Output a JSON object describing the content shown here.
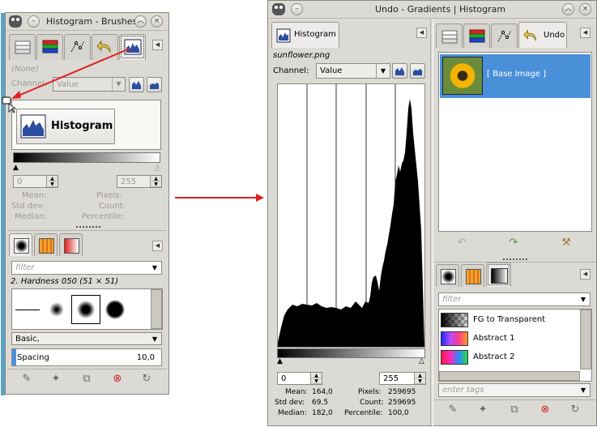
{
  "left_window": {
    "title": "Histogram - Brushes",
    "image_label": "(None)",
    "channel_label": "Channel:",
    "channel_value": "Value",
    "histogram_button_label": "Histogram",
    "range_low": "0",
    "range_high": "255",
    "stats_left": [
      "Mean:",
      "Std dev:",
      "Median:"
    ],
    "stats_right": [
      "Pixels:",
      "Count:",
      "Percentile:"
    ],
    "filter_placeholder": "filter",
    "brush_name": "2. Hardness 050 (51 × 51)",
    "preset": "Basic,",
    "spacing_label": "Spacing",
    "spacing_value": "10,0"
  },
  "right_window": {
    "title": "Undo - Gradients | Histogram",
    "histogram_tab_label": "Histogram",
    "undo_tab_label": "Undo",
    "image_name": "sunflower.png",
    "channel_label": "Channel:",
    "channel_value": "Value",
    "range_low": "0",
    "range_high": "255",
    "stats": [
      {
        "label": "Mean:",
        "value": "164,0"
      },
      {
        "label": "Std dev:",
        "value": "69,5"
      },
      {
        "label": "Median:",
        "value": "182,0"
      }
    ],
    "stats_right": [
      {
        "label": "Pixels:",
        "value": "259695"
      },
      {
        "label": "Count:",
        "value": "259695"
      },
      {
        "label": "Percentile:",
        "value": "100,0"
      }
    ],
    "undo_item": "[ Base Image ]",
    "filter_placeholder": "filter",
    "gradients": [
      "FG to Transparent",
      "Abstract 1",
      "Abstract 2"
    ],
    "tags_placeholder": "enter tags"
  },
  "colors": {
    "window_bg": "#dcdad5",
    "selection": "#4a90d9",
    "arrow": "#e02020"
  },
  "icons": [
    "gimp-icon",
    "minimize-icon",
    "close-icon",
    "histogram-icon",
    "layers-icon",
    "channels-icon",
    "paths-icon",
    "undo-icon",
    "redo-icon",
    "clear-icon",
    "brush-icon",
    "pattern-icon",
    "gradient-icon",
    "edit-icon",
    "new-icon",
    "duplicate-icon",
    "delete-icon",
    "refresh-icon",
    "cursor-icon"
  ]
}
